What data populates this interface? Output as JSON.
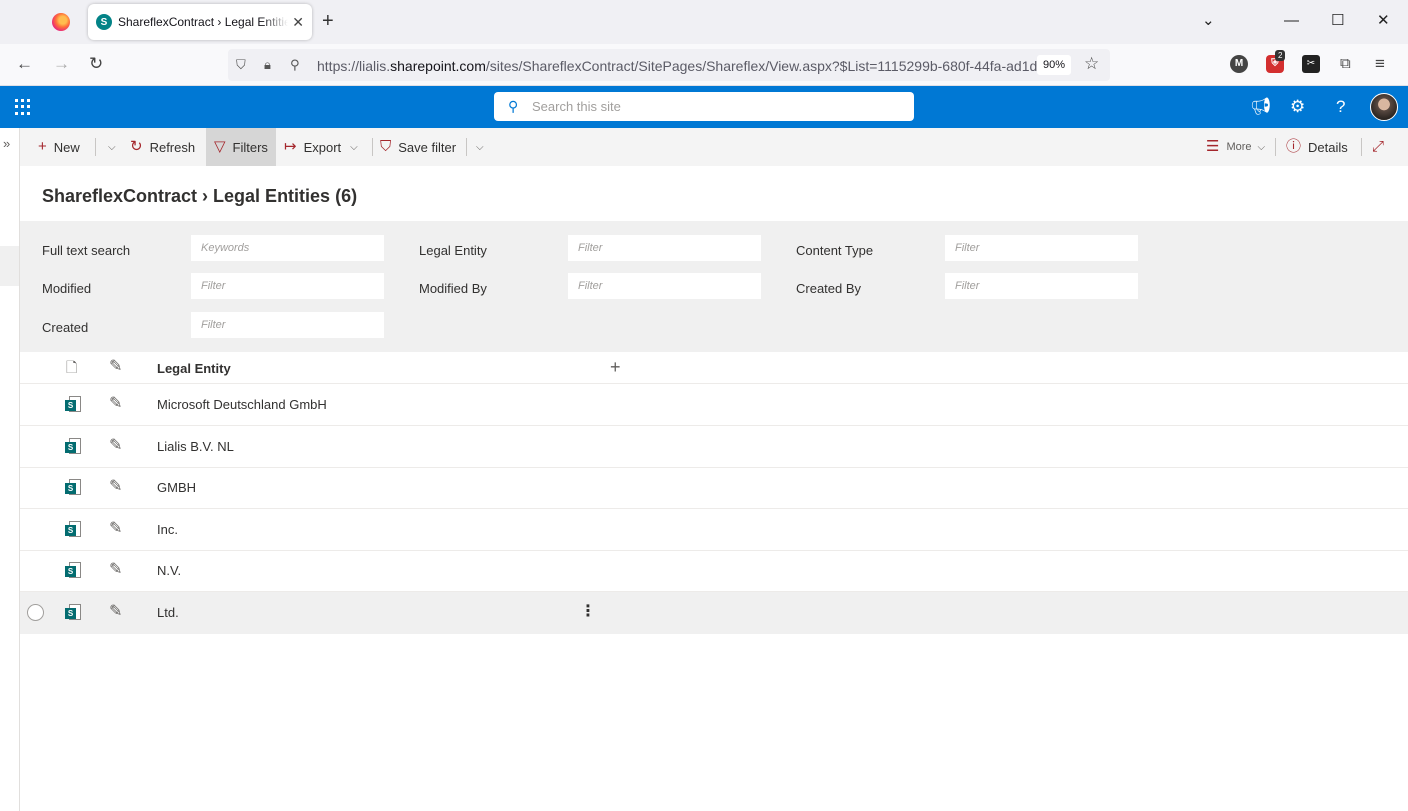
{
  "browser": {
    "tab_title": "ShareflexContract › Legal Entities",
    "tab_icon_letter": "S",
    "url_prefix": "https://lialis.",
    "url_domain": "sharepoint.com",
    "url_path": "/sites/ShareflexContract/SitePages/Shareflex/View.aspx?$List=1115299b-680f-44fa-ad1d",
    "zoom": "90%",
    "extension_badge": "2",
    "extension_m": "M"
  },
  "suite": {
    "search_placeholder": "Search this site"
  },
  "commands": {
    "new": "New",
    "refresh": "Refresh",
    "filters": "Filters",
    "export": "Export",
    "save_filter": "Save filter",
    "more": "More",
    "details": "Details"
  },
  "page": {
    "title": "ShareflexContract › Legal Entities (6)"
  },
  "filters": {
    "full_text_search": {
      "label": "Full text search",
      "placeholder": "Keywords"
    },
    "legal_entity": {
      "label": "Legal Entity",
      "placeholder": "Filter"
    },
    "content_type": {
      "label": "Content Type",
      "placeholder": "Filter"
    },
    "modified": {
      "label": "Modified",
      "placeholder": "Filter"
    },
    "modified_by": {
      "label": "Modified By",
      "placeholder": "Filter"
    },
    "created_by": {
      "label": "Created By",
      "placeholder": "Filter"
    },
    "created": {
      "label": "Created",
      "placeholder": "Filter"
    }
  },
  "list": {
    "column_header": "Legal Entity",
    "rows": [
      {
        "legal_entity": "Microsoft Deutschland GmbH"
      },
      {
        "legal_entity": "Lialis B.V. NL"
      },
      {
        "legal_entity": "GMBH"
      },
      {
        "legal_entity": "Inc."
      },
      {
        "legal_entity": "N.V."
      },
      {
        "legal_entity": "Ltd."
      }
    ]
  },
  "icons": {
    "doc_badge": "S"
  }
}
